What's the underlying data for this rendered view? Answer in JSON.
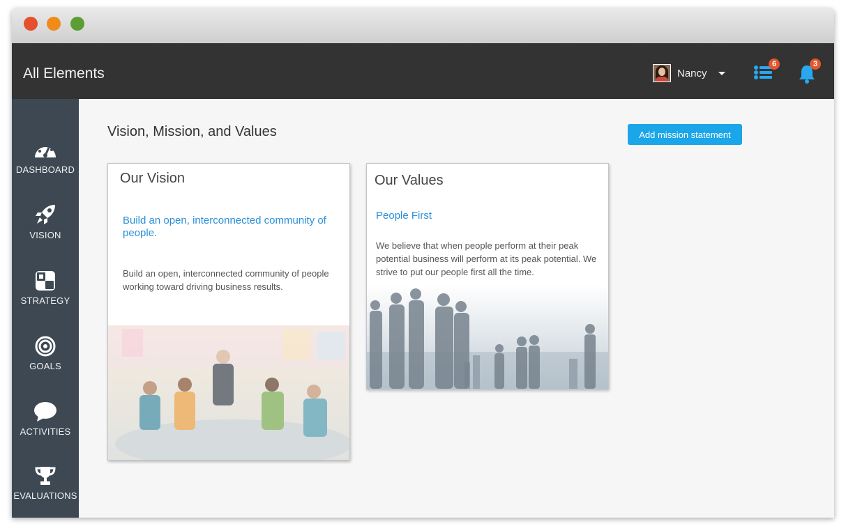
{
  "window": {
    "controls": [
      "close",
      "minimize",
      "maximize"
    ]
  },
  "header": {
    "title": "All Elements",
    "user": {
      "name": "Nancy"
    },
    "tasks_badge": "6",
    "notifications_badge": "3"
  },
  "sidebar": {
    "items": [
      {
        "label": "DASHBOARD",
        "icon": "dashboard-gauge-icon"
      },
      {
        "label": "VISION",
        "icon": "rocket-icon"
      },
      {
        "label": "STRATEGY",
        "icon": "strategy-board-icon"
      },
      {
        "label": "GOALS",
        "icon": "target-icon"
      },
      {
        "label": "ACTIVITIES",
        "icon": "chat-bubble-icon"
      },
      {
        "label": "EVALUATIONS",
        "icon": "trophy-icon"
      }
    ]
  },
  "main": {
    "page_title": "Vision, Mission, and Values",
    "add_button": "Add mission statement",
    "cards": {
      "vision": {
        "title": "Our Vision",
        "headline": "Build an open, interconnected community of people.",
        "body": "Build an open, interconnected community of people working toward driving business results."
      },
      "values": {
        "title": "Our Values",
        "headline": "People First",
        "body": "We believe that when people perform at their peak potential business will perform at its peak potential. We strive to put our people first all the time."
      }
    }
  },
  "colors": {
    "topbar": "#333333",
    "sidebar": "#3d4852",
    "accent": "#1aa6e8",
    "link": "#2a8fd8",
    "badge": "#e4572e"
  }
}
